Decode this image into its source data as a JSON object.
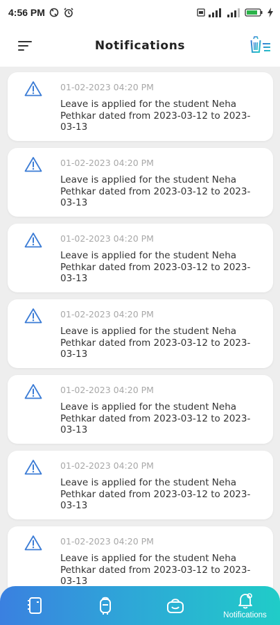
{
  "status_bar": {
    "time": "4:56 PM",
    "battery_label": "81"
  },
  "header": {
    "title": "Notifications",
    "menu_icon": "menu-lines-icon",
    "clear_icon": "trash-clear-icon"
  },
  "notifications": [
    {
      "icon": "warning-icon",
      "time": "01-02-2023 04:20 PM",
      "message": "Leave is applied for the student Neha Pethkar dated from 2023-03-12 to 2023-03-13"
    },
    {
      "icon": "warning-icon",
      "time": "01-02-2023 04:20 PM",
      "message": "Leave is applied for the student Neha Pethkar dated from 2023-03-12 to 2023-03-13"
    },
    {
      "icon": "warning-icon",
      "time": "01-02-2023 04:20 PM",
      "message": "Leave is applied for the student Neha Pethkar dated from 2023-03-12 to 2023-03-13"
    },
    {
      "icon": "warning-icon",
      "time": "01-02-2023 04:20 PM",
      "message": "Leave is applied for the student Neha Pethkar dated from 2023-03-12 to 2023-03-13"
    },
    {
      "icon": "warning-icon",
      "time": "01-02-2023 04:20 PM",
      "message": "Leave is applied for the student Neha Pethkar dated from 2023-03-12 to 2023-03-13"
    },
    {
      "icon": "warning-icon",
      "time": "01-02-2023 04:20 PM",
      "message": "Leave is applied for the student Neha Pethkar dated from 2023-03-12 to 2023-03-13"
    },
    {
      "icon": "warning-icon",
      "time": "01-02-2023 04:20 PM",
      "message": "Leave is applied for the student Neha Pethkar dated from 2023-03-12 to 2023-03-13"
    }
  ],
  "bottom_nav": {
    "items": [
      {
        "icon": "document-icon",
        "label": ""
      },
      {
        "icon": "backpack-icon",
        "label": ""
      },
      {
        "icon": "bag-icon",
        "label": ""
      },
      {
        "icon": "bell-icon",
        "label": "Notifications"
      }
    ]
  },
  "colors": {
    "accent": "#3a7bd5",
    "nav_gradient_start": "#3a80e0",
    "nav_gradient_end": "#20ccc8",
    "background": "#eeeeee"
  }
}
